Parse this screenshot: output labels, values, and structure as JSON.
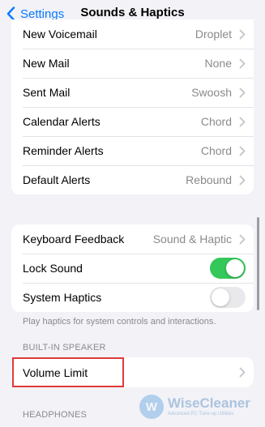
{
  "navbar": {
    "back_label": "Settings",
    "title": "Sounds & Haptics"
  },
  "alerts": [
    {
      "label": "New Voicemail",
      "value": "Droplet"
    },
    {
      "label": "New Mail",
      "value": "None"
    },
    {
      "label": "Sent Mail",
      "value": "Swoosh"
    },
    {
      "label": "Calendar Alerts",
      "value": "Chord"
    },
    {
      "label": "Reminder Alerts",
      "value": "Chord"
    },
    {
      "label": "Default Alerts",
      "value": "Rebound"
    }
  ],
  "system": {
    "keyboard_feedback": {
      "label": "Keyboard Feedback",
      "value": "Sound & Haptic"
    },
    "lock_sound": {
      "label": "Lock Sound",
      "on": true
    },
    "system_haptics": {
      "label": "System Haptics",
      "on": false
    },
    "footnote": "Play haptics for system controls and interactions."
  },
  "builtin_speaker": {
    "header": "BUILT-IN SPEAKER",
    "volume_limit_label": "Volume Limit"
  },
  "headphones": {
    "header": "HEADPHONES"
  },
  "watermark": {
    "logo_letter": "W",
    "name": "WiseCleaner",
    "tagline": "Advanced PC Tune-up Utilities"
  },
  "colors": {
    "accent": "#0a7aff",
    "toggle_on": "#34c759",
    "toggle_off": "#e9e9eb",
    "highlight": "#e03a3a",
    "background": "#f2f2f7"
  },
  "icons": {
    "back": "chevron-left-icon",
    "disclosure": "chevron-right-icon"
  }
}
